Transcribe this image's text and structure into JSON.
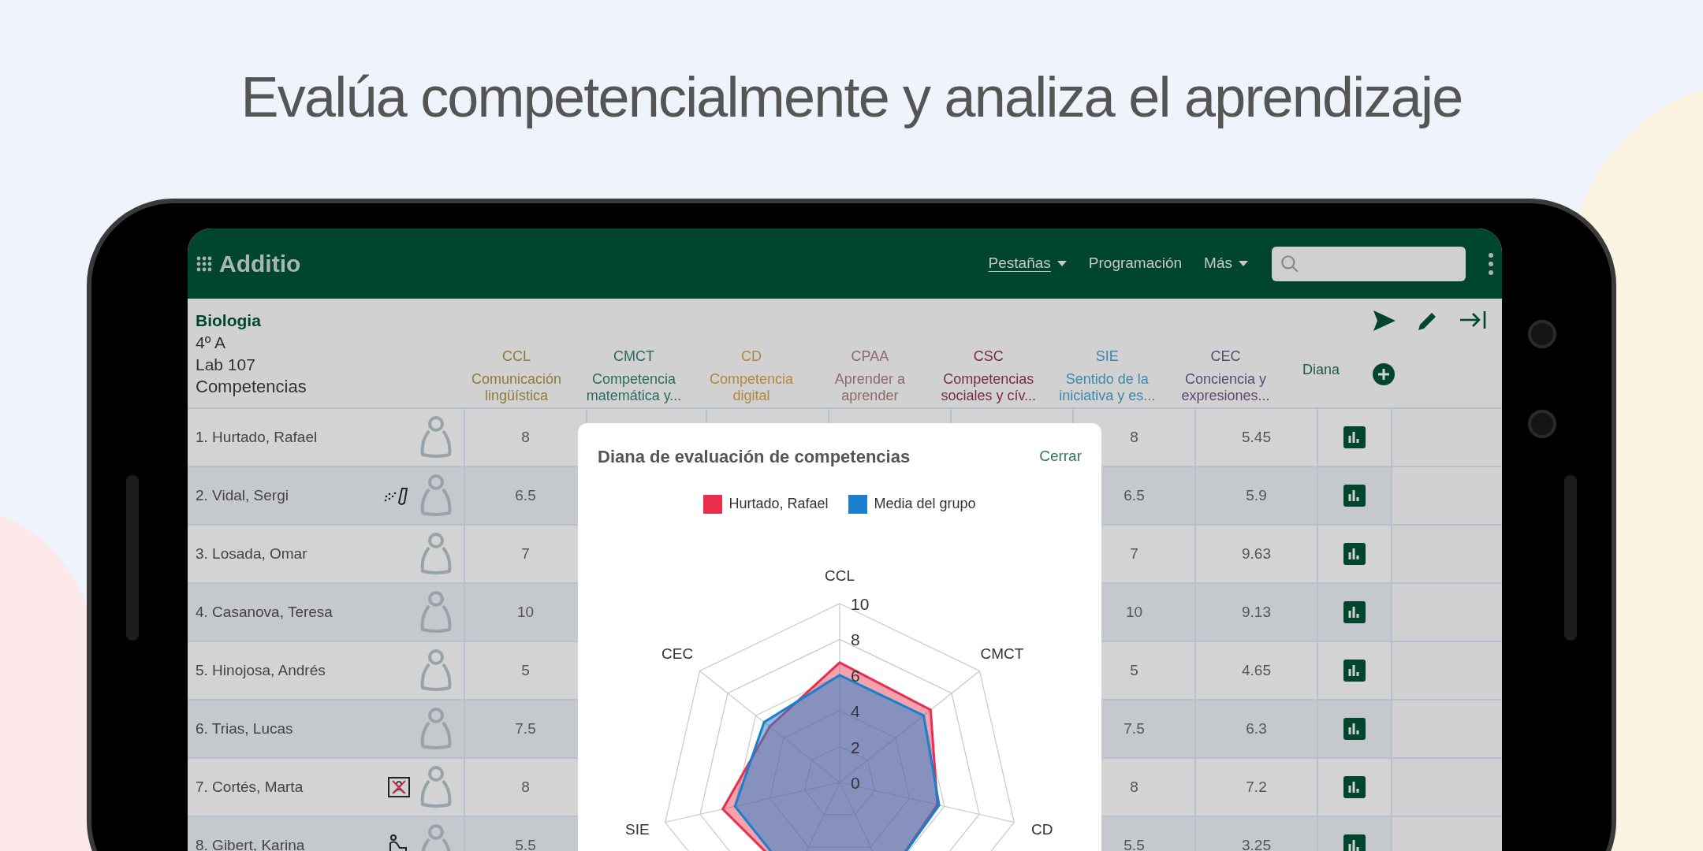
{
  "headline": "Evalúa competencialmente y analiza el aprendizaje",
  "app": {
    "logo": "Additio",
    "nav": [
      {
        "label": "Pestañas",
        "dropdown": true,
        "underlined": true
      },
      {
        "label": "Programación",
        "dropdown": false,
        "underlined": false
      },
      {
        "label": "Más",
        "dropdown": true,
        "underlined": false
      }
    ]
  },
  "group": {
    "subject": "Biologia",
    "class": "4º A",
    "room": "Lab 107",
    "view": "Competencias"
  },
  "columns": [
    {
      "code": "CCL",
      "name": "Comunicación lingüística",
      "color": "#8c7d3c"
    },
    {
      "code": "CMCT",
      "name": "Competencia matemática y...",
      "color": "#2c6b62"
    },
    {
      "code": "CD",
      "name": "Competencia digital",
      "color": "#b0873c"
    },
    {
      "code": "CPAA",
      "name": "Aprender a aprender",
      "color": "#8a6a6c"
    },
    {
      "code": "CSC",
      "name": "Competencias sociales y cív...",
      "color": "#7a2c40"
    },
    {
      "code": "SIE",
      "name": "Sentido de la iniciativa y es...",
      "color": "#3a88ac"
    },
    {
      "code": "CEC",
      "name": "Conciencia y expresiones...",
      "color": "#5c4a6e"
    }
  ],
  "diana_header": "Diana",
  "rows": [
    {
      "name": "1. Hurtado, Rafael",
      "ccl": "8",
      "sie": "8",
      "cec": "5.45"
    },
    {
      "name": "2. Vidal, Sergi",
      "kind": "inhaler",
      "ccl": "6.5",
      "sie": "6.5",
      "cec": "5.9"
    },
    {
      "name": "3. Losada, Omar",
      "ccl": "7",
      "sie": "7",
      "cec": "9.63"
    },
    {
      "name": "4. Casanova, Teresa",
      "ccl": "10",
      "sie": "10",
      "cec": "9.13"
    },
    {
      "name": "5. Hinojosa, Andrés",
      "ccl": "5",
      "sie": "5",
      "cec": "4.65"
    },
    {
      "name": "6. Trias, Lucas",
      "ccl": "7.5",
      "sie": "7.5",
      "cec": "6.3"
    },
    {
      "name": "7. Cortés, Marta",
      "kind": "no-photo",
      "ccl": "8",
      "sie": "8",
      "cec": "7.2"
    },
    {
      "name": "8. Gibert, Karina",
      "kind": "desk",
      "ccl": "5.5",
      "sie": "5.5",
      "cec": "3.25"
    }
  ],
  "modal": {
    "title": "Diana de evaluación de competencias",
    "close": "Cerrar",
    "radar": {
      "axis_labels": [
        "CCL",
        "CMCT",
        "CD",
        "SIE",
        "CEC"
      ],
      "scale_labels": [
        "10",
        "8",
        "6",
        "4",
        "2",
        "0"
      ],
      "legend": [
        {
          "name": "Hurtado, Rafael",
          "color": "#e8304e"
        },
        {
          "name": "Media del grupo",
          "color": "#1a7fcc"
        }
      ]
    }
  }
}
